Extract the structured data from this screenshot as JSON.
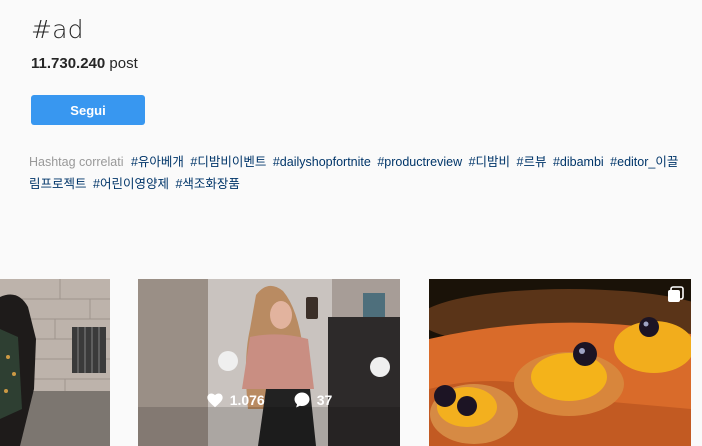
{
  "hashtag": {
    "title": "#ad",
    "post_count": "11.730.240",
    "post_label": "post"
  },
  "follow_button": {
    "label": "Segui"
  },
  "related": {
    "label": "Hashtag correlati",
    "tags": [
      "#유아베개",
      "#디밤비이벤트",
      "#dailyshopfortnite",
      "#productreview",
      "#디밤비",
      "#르뷰",
      "#dibambi",
      "#editor_이끌림프로젝트",
      "#어린이영양제",
      "#색조화장품"
    ]
  },
  "posts": [
    {
      "likes": "",
      "comments": ""
    },
    {
      "likes": "1.076",
      "comments": "37"
    },
    {
      "likes": "",
      "comments": "",
      "multi": true
    }
  ],
  "icons": {
    "like": "heart-icon",
    "comment": "comment-icon",
    "multi": "multi-image-icon"
  },
  "colors": {
    "accent": "#3897f0",
    "link": "#003569",
    "muted": "#999999",
    "background": "#fafafa"
  }
}
